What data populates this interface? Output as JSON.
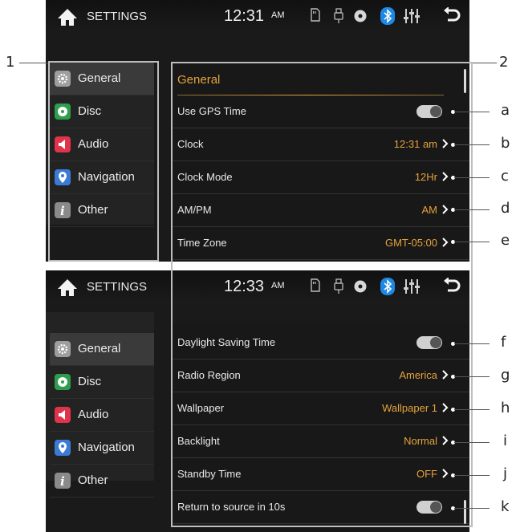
{
  "screens": [
    {
      "header": {
        "title": "SETTINGS",
        "time": "12:31",
        "ampm": "AM"
      },
      "sidebar": [
        {
          "label": "General",
          "active": true
        },
        {
          "label": "Disc",
          "active": false
        },
        {
          "label": "Audio",
          "active": false
        },
        {
          "label": "Navigation",
          "active": false
        },
        {
          "label": "Other",
          "active": false
        }
      ],
      "section_title": "General",
      "rows": [
        {
          "label": "Use GPS Time",
          "type": "toggle",
          "on": false
        },
        {
          "label": "Clock",
          "type": "value",
          "value": "12:31 am"
        },
        {
          "label": "Clock Mode",
          "type": "value",
          "value": "12Hr"
        },
        {
          "label": "AM/PM",
          "type": "value",
          "value": "AM"
        },
        {
          "label": "Time Zone",
          "type": "value",
          "value": "GMT-05:00"
        }
      ]
    },
    {
      "header": {
        "title": "SETTINGS",
        "time": "12:33",
        "ampm": "AM"
      },
      "sidebar": [
        {
          "label": "General",
          "active": true
        },
        {
          "label": "Disc",
          "active": false
        },
        {
          "label": "Audio",
          "active": false
        },
        {
          "label": "Navigation",
          "active": false
        },
        {
          "label": "Other",
          "active": false
        }
      ],
      "rows": [
        {
          "label": "Daylight Saving Time",
          "type": "toggle",
          "on": false
        },
        {
          "label": "Radio Region",
          "type": "value",
          "value": "America"
        },
        {
          "label": "Wallpaper",
          "type": "value",
          "value": "Wallpaper 1"
        },
        {
          "label": "Backlight",
          "type": "value",
          "value": "Normal"
        },
        {
          "label": "Standby Time",
          "type": "value",
          "value": "OFF"
        },
        {
          "label": "Return to source in 10s",
          "type": "toggle",
          "on": false
        }
      ]
    }
  ],
  "callouts": {
    "left": "1",
    "right": "2",
    "letters": [
      "a",
      "b",
      "c",
      "d",
      "e",
      "f",
      "g",
      "h",
      "i",
      "j",
      "k"
    ]
  },
  "icons": {
    "home": "home-icon",
    "sd": "sd-card-icon",
    "usb": "usb-icon",
    "disc": "disc-icon",
    "bluetooth": "bluetooth-icon",
    "eq": "equalizer-icon",
    "back": "back-arrow-icon"
  },
  "colors": {
    "accent": "#e6a23c",
    "bluetooth": "#1e88e5",
    "general_icon": "#9e9e9e",
    "disc_icon": "#2e9e4e",
    "audio_icon": "#e0344a",
    "navigation_icon": "#3a7bd5",
    "other_icon": "#8a8a8a"
  }
}
